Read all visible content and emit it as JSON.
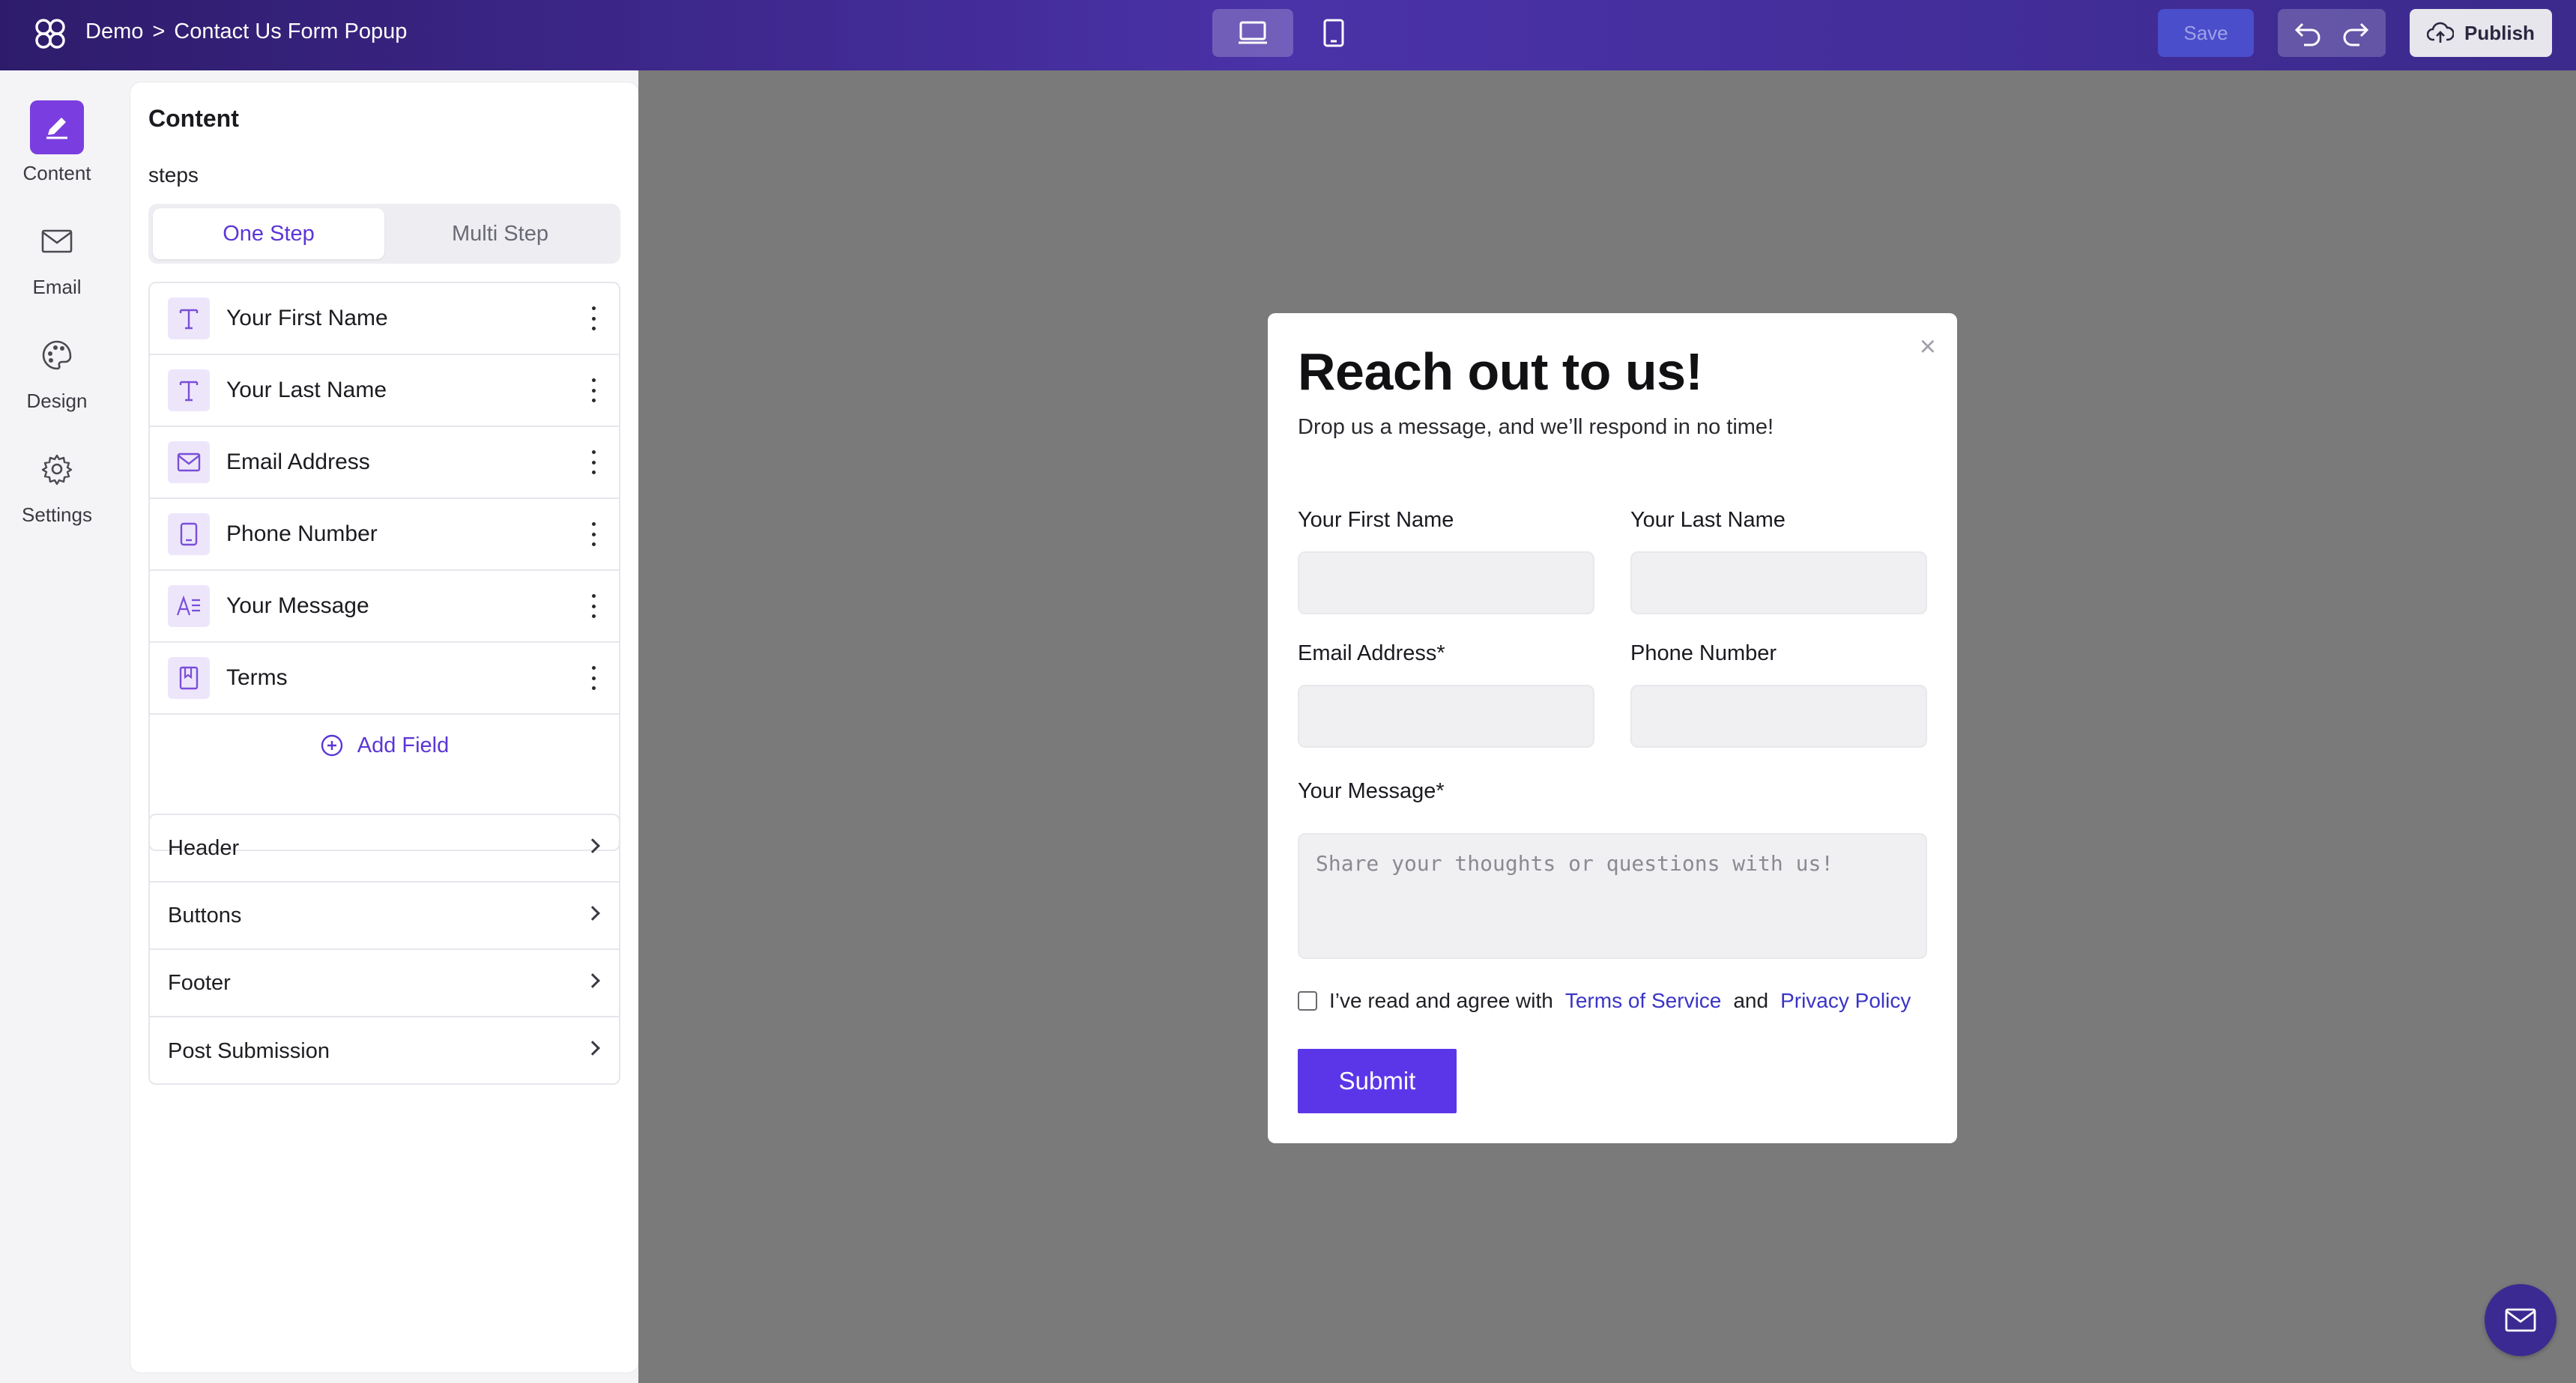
{
  "topbar": {
    "breadcrumb_root": "Demo",
    "breadcrumb_sep": ">",
    "breadcrumb_page": "Contact Us Form Popup",
    "save_label": "Save",
    "publish_label": "Publish"
  },
  "rail": {
    "items": [
      {
        "label": "Content",
        "icon": "pencil-icon"
      },
      {
        "label": "Email",
        "icon": "envelope-icon"
      },
      {
        "label": "Design",
        "icon": "palette-icon"
      },
      {
        "label": "Settings",
        "icon": "gear-icon"
      }
    ]
  },
  "panel": {
    "title": "Content",
    "steps_label": "steps",
    "step_options": [
      "One Step",
      "Multi Step"
    ],
    "selected_step": "One Step",
    "fields": [
      {
        "label": "Your First Name",
        "icon": "text-icon"
      },
      {
        "label": "Your Last Name",
        "icon": "text-icon"
      },
      {
        "label": "Email Address",
        "icon": "envelope-icon"
      },
      {
        "label": "Phone Number",
        "icon": "phone-icon"
      },
      {
        "label": "Your Message",
        "icon": "paragraph-icon"
      },
      {
        "label": "Terms",
        "icon": "bookmark-icon"
      }
    ],
    "add_field_label": "Add Field",
    "sections": [
      "Header",
      "Buttons",
      "Footer",
      "Post Submission"
    ]
  },
  "modal": {
    "title": "Reach out to us!",
    "subtitle": "Drop us a message, and we’ll respond in no time!",
    "close": "×",
    "first_name_label": "Your First Name",
    "last_name_label": "Your Last Name",
    "email_label": "Email Address*",
    "phone_label": "Phone Number",
    "message_label": "Your Message*",
    "message_placeholder": "Share your thoughts or questions with us!",
    "terms_prefix": "I’ve read and agree with",
    "terms_link": "Terms of Service",
    "terms_and": "and",
    "privacy_link": "Privacy Policy",
    "submit_label": "Submit"
  },
  "colors": {
    "accent": "#5b36e8",
    "topbar": "#3c2a8c",
    "canvas": "#7a7a7a"
  }
}
